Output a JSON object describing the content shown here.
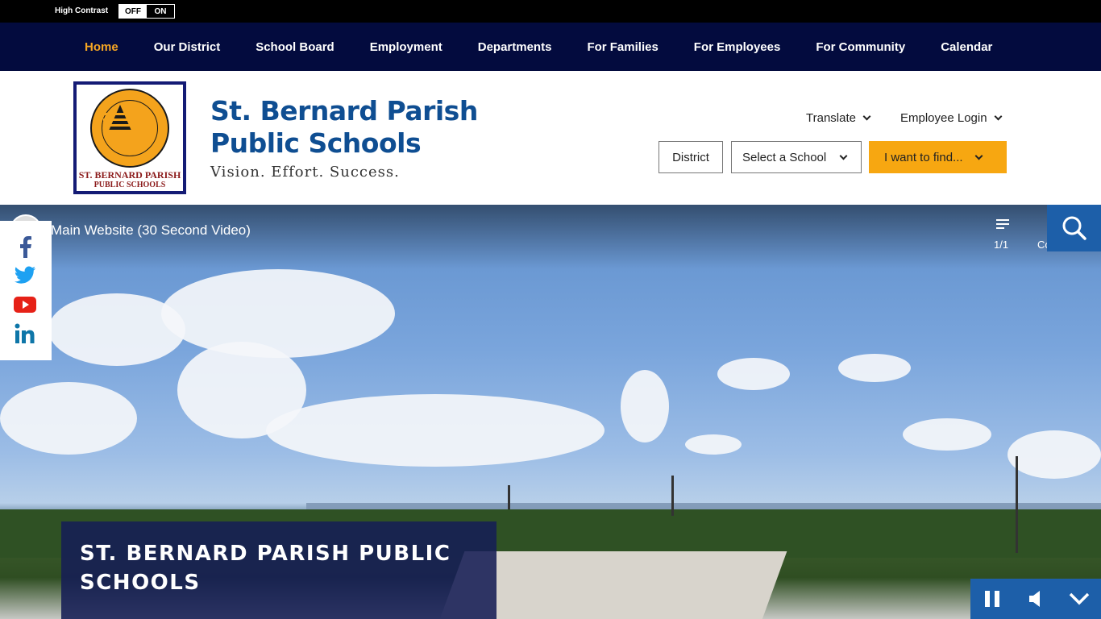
{
  "utility": {
    "high_contrast_label": "High Contrast",
    "off_label": "OFF",
    "on_label": "ON"
  },
  "nav": {
    "items": [
      {
        "label": "Home",
        "active": true
      },
      {
        "label": "Our District"
      },
      {
        "label": "School Board"
      },
      {
        "label": "Employment"
      },
      {
        "label": "Departments"
      },
      {
        "label": "For Families"
      },
      {
        "label": "For Employees"
      },
      {
        "label": "For Community"
      },
      {
        "label": "Calendar"
      }
    ]
  },
  "header": {
    "logo_text_line1": "ST. BERNARD PARISH",
    "logo_text_line2": "PUBLIC SCHOOLS",
    "site_title": "St. Bernard Parish Public Schools",
    "tagline": "Vision. Effort. Success.",
    "translate_label": "Translate",
    "employee_login_label": "Employee Login",
    "district_label": "District",
    "select_school_label": "Select a School",
    "find_label": "I want to find..."
  },
  "hero": {
    "video_title": "Main Website (30 Second Video)",
    "playlist_count": "1/1",
    "co_text": "Co",
    "caption": "ST. BERNARD PARISH PUBLIC SCHOOLS"
  },
  "colors": {
    "nav_bg": "#030b3e",
    "accent_orange": "#f7a711",
    "title_blue": "#0f4e92",
    "search_blue": "#1d5fa9",
    "caption_bg": "#161e55"
  }
}
